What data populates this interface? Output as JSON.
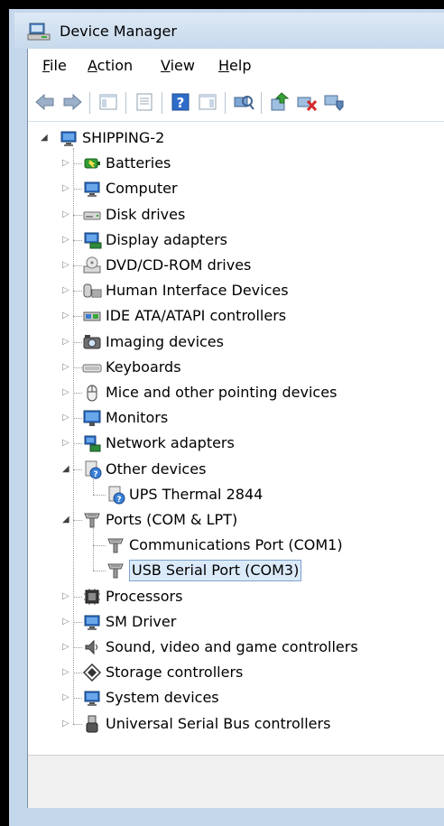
{
  "window": {
    "title": "Device Manager"
  },
  "menu": [
    {
      "label": "File",
      "mn": "F",
      "rest": "ile"
    },
    {
      "label": "Action",
      "mn": "A",
      "rest": "ction"
    },
    {
      "label": "View",
      "mn": "V",
      "rest": "iew"
    },
    {
      "label": "Help",
      "mn": "H",
      "rest": "elp"
    }
  ],
  "tree": {
    "root": "SHIPPING-2",
    "items": [
      {
        "label": "Batteries",
        "icon": "battery-icon"
      },
      {
        "label": "Computer",
        "icon": "computer-icon"
      },
      {
        "label": "Disk drives",
        "icon": "disk-drive-icon"
      },
      {
        "label": "Display adapters",
        "icon": "display-adapter-icon"
      },
      {
        "label": "DVD/CD-ROM drives",
        "icon": "dvd-drive-icon"
      },
      {
        "label": "Human Interface Devices",
        "icon": "hid-icon"
      },
      {
        "label": "IDE ATA/ATAPI controllers",
        "icon": "ide-controller-icon"
      },
      {
        "label": "Imaging devices",
        "icon": "imaging-device-icon"
      },
      {
        "label": "Keyboards",
        "icon": "keyboard-icon"
      },
      {
        "label": "Mice and other pointing devices",
        "icon": "mouse-icon"
      },
      {
        "label": "Monitors",
        "icon": "monitor-icon"
      },
      {
        "label": "Network adapters",
        "icon": "network-adapter-icon"
      },
      {
        "label": "Other devices",
        "icon": "unknown-device-icon",
        "expanded": true,
        "children": [
          {
            "label": "UPS Thermal 2844",
            "icon": "unknown-device-icon"
          }
        ]
      },
      {
        "label": "Ports (COM & LPT)",
        "icon": "port-icon",
        "expanded": true,
        "children": [
          {
            "label": "Communications Port (COM1)",
            "icon": "port-icon"
          },
          {
            "label": "USB Serial Port (COM3)",
            "icon": "port-icon",
            "selected": true
          }
        ]
      },
      {
        "label": "Processors",
        "icon": "processor-icon"
      },
      {
        "label": "SM Driver",
        "icon": "computer-icon"
      },
      {
        "label": "Sound, video and game controllers",
        "icon": "speaker-icon"
      },
      {
        "label": "Storage controllers",
        "icon": "storage-controller-icon"
      },
      {
        "label": "System devices",
        "icon": "computer-icon"
      },
      {
        "label": "Universal Serial Bus controllers",
        "icon": "usb-icon"
      }
    ]
  },
  "colors": {
    "selection_bg": "#dbeaf9",
    "selection_border": "#7da2ce",
    "titlebar": "#c7d9ec"
  }
}
